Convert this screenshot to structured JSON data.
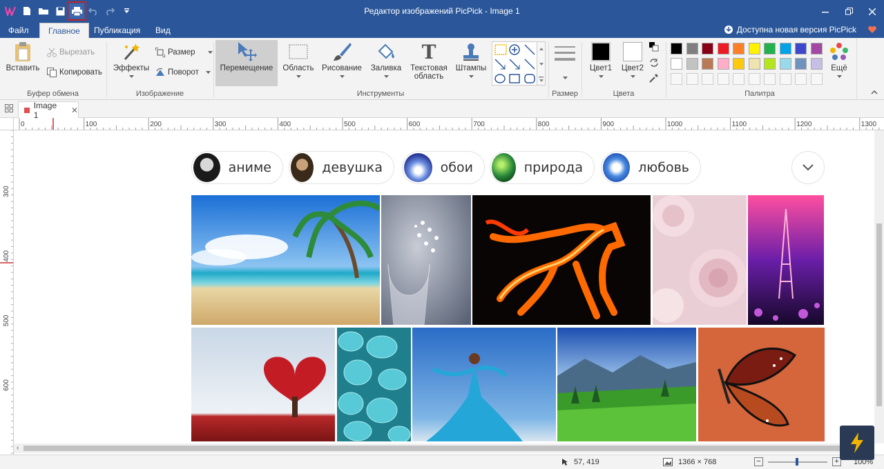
{
  "window": {
    "title": "Редактор изображений PicPick - Image 1"
  },
  "menu": {
    "file": "Файл",
    "home": "Главное",
    "publish": "Публикация",
    "view": "Вид",
    "update_notice": "Доступна новая версия PicPick"
  },
  "ribbon": {
    "clipboard": {
      "paste": "Вставить",
      "cut": "Вырезать",
      "copy": "Копировать",
      "group": "Буфер обмена"
    },
    "image": {
      "effects": "Эффекты",
      "resize": "Размер",
      "rotate": "Поворот",
      "group": "Изображение"
    },
    "tools": {
      "move": "Перемещение",
      "area": "Область",
      "draw": "Рисование",
      "fill": "Заливка",
      "text_line1": "Текстовая",
      "text_line2": "область",
      "stamps": "Штампы",
      "group": "Инструменты"
    },
    "size": {
      "group": "Размер"
    },
    "colors": {
      "color1": "Цвет1",
      "color2": "Цвет2",
      "group": "Цвета"
    },
    "palette": {
      "group": "Палитра",
      "more": "Ещё",
      "row1": [
        "#000000",
        "#7f7f7f",
        "#880015",
        "#ed1c24",
        "#ff7f27",
        "#fff200",
        "#22b14c",
        "#00a2e8",
        "#3f48cc",
        "#a349a4"
      ],
      "row2": [
        "#ffffff",
        "#c3c3c3",
        "#b97a57",
        "#ffaec9",
        "#ffc90e",
        "#efe4b0",
        "#b5e61d",
        "#99d9ea",
        "#7092be",
        "#c8bfe7"
      ]
    }
  },
  "tab": {
    "name": "Image 1"
  },
  "ruler": {
    "h_ticks": [
      "0",
      "100",
      "200",
      "300",
      "400",
      "500",
      "600",
      "700",
      "800",
      "900",
      "1000",
      "1100",
      "1200",
      "1300"
    ],
    "v_ticks": [
      "300",
      "400",
      "500",
      "600"
    ]
  },
  "chips": [
    "аниме",
    "девушка",
    "обои",
    "природа",
    "любовь"
  ],
  "status": {
    "cursor": "57, 419",
    "size": "1366 × 768",
    "zoom": "100%"
  }
}
